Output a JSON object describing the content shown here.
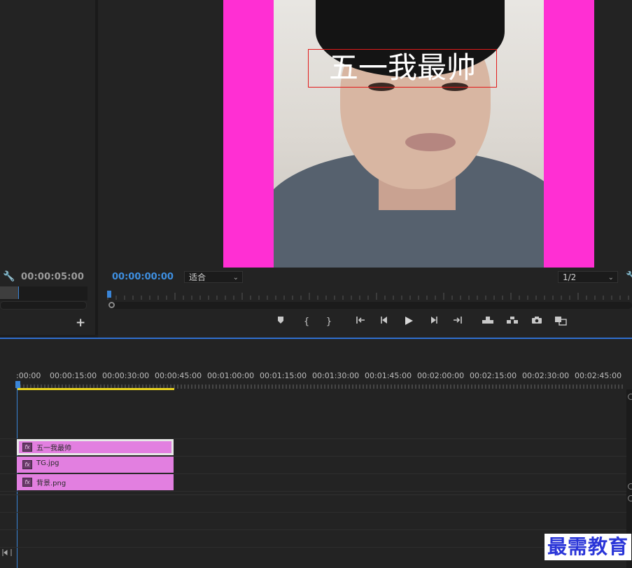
{
  "source_monitor": {
    "timecode": "00:00:05:00",
    "add_button": "+"
  },
  "program_monitor": {
    "timecode": "00:00:00:00",
    "fit_select": "适合",
    "resolution_select": "1/2",
    "overlay_text": "五一我最帅",
    "transport": {
      "add_marker": "▼",
      "mark_in": "{",
      "mark_out": "}",
      "go_to_in": "{←",
      "step_back": "◀|",
      "play": "▶",
      "step_forward": "|▶",
      "go_to_out": "→}",
      "lift": "⇡",
      "extract": "⇣",
      "export_frame": "📷",
      "compare": "⧉"
    }
  },
  "timeline": {
    "ruler_labels": [
      ":00:00",
      "00:00:15:00",
      "00:00:30:00",
      "00:00:45:00",
      "00:01:00:00",
      "00:01:15:00",
      "00:01:30:00",
      "00:01:45:00",
      "00:02:00:00",
      "00:02:15:00",
      "00:02:30:00",
      "00:02:45:00"
    ],
    "clips": [
      {
        "name": "五一我最帅",
        "fx": "fx",
        "selected": true
      },
      {
        "name": "TG.jpg",
        "fx": "fx",
        "selected": false
      },
      {
        "name": "背景.png",
        "fx": "fx",
        "selected": false
      }
    ]
  },
  "watermark": "最需教育",
  "colors": {
    "accent_blue": "#3a85d8",
    "clip_pink": "#e27fe0",
    "frame_magenta": "#ff2fd3",
    "work_area_yellow": "#e8d21e"
  }
}
